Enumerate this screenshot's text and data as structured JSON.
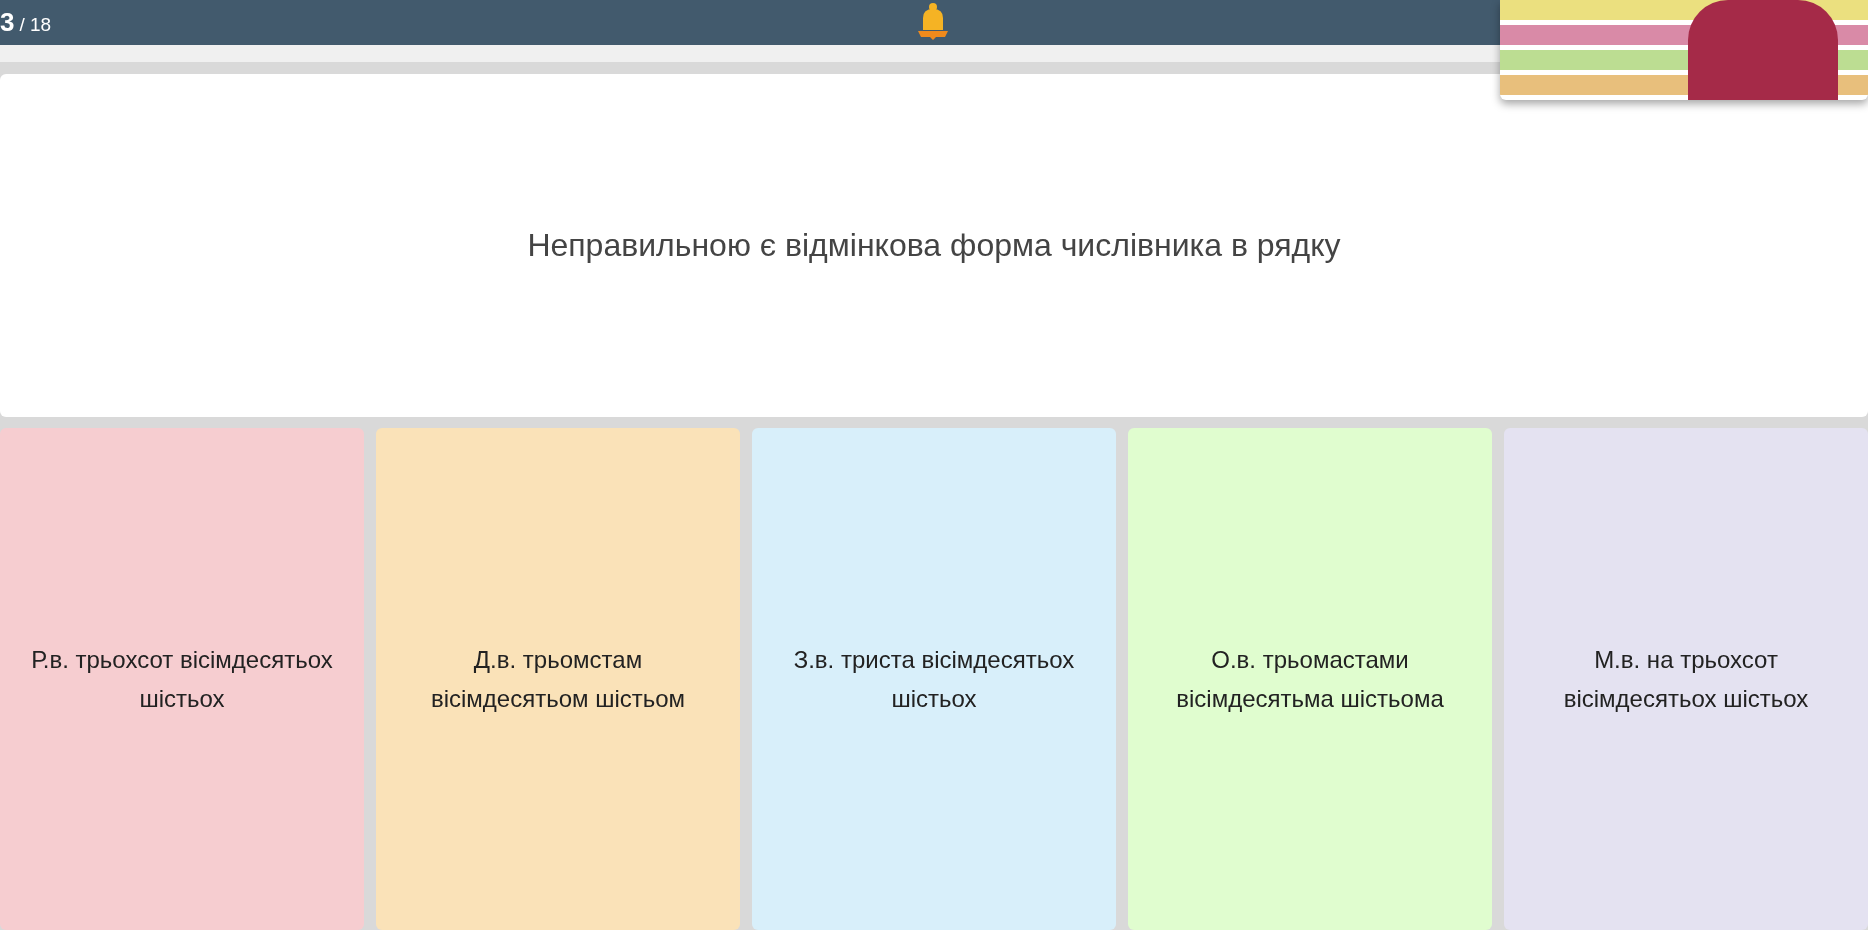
{
  "top_bar": {
    "current": "3",
    "total": "/ 18"
  },
  "question": {
    "text": "Неправильною є відмінкова форма числівника в рядку"
  },
  "options": [
    {
      "text": "Р.в. трьохсот вісімдесятьох шістьох",
      "color": "#f6cdd0"
    },
    {
      "text": "Д.в. трьомстам вісімдесятьом шістьом",
      "color": "#fae2b8"
    },
    {
      "text": "З.в. триста вісімдесятьох шістьох",
      "color": "#d8effa"
    },
    {
      "text": "О.в. трьомастами вісімдесятьма шістьома",
      "color": "#e0fdcf"
    },
    {
      "text": "М.в. на трьохсот вісімдесятьох шістьох",
      "color": "#e4e2f1"
    }
  ]
}
